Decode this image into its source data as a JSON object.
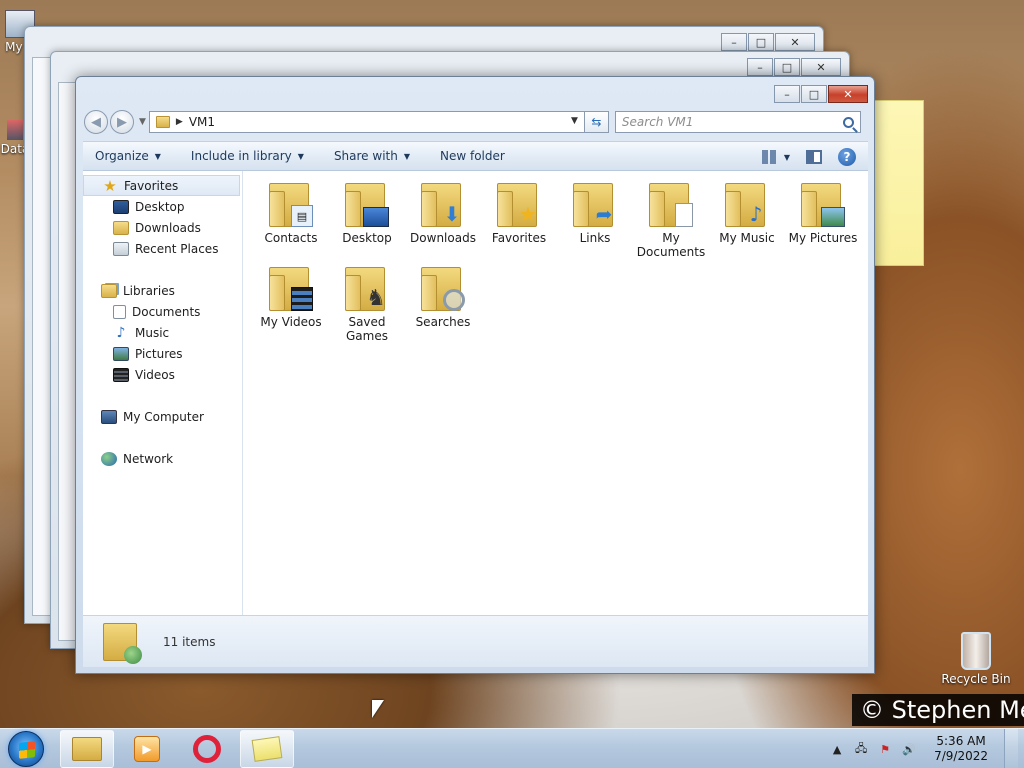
{
  "desktop": {
    "icons": [
      {
        "label": "My C"
      },
      {
        "label": "Data"
      },
      {
        "label": "Recycle Bin"
      }
    ],
    "watermark": "© Stephen Me"
  },
  "window": {
    "title": "VM1",
    "address_path": "VM1",
    "search_placeholder": "Search VM1",
    "caption": {
      "minimize": "–",
      "maximize": "□",
      "close": "✕"
    }
  },
  "toolbar": {
    "organize": "Organize",
    "include_in_library": "Include in library",
    "share_with": "Share with",
    "new_folder": "New folder"
  },
  "nav_pane": {
    "favorites": {
      "label": "Favorites",
      "items": [
        "Desktop",
        "Downloads",
        "Recent Places"
      ]
    },
    "libraries": {
      "label": "Libraries",
      "items": [
        "Documents",
        "Music",
        "Pictures",
        "Videos"
      ]
    },
    "computer": "My Computer",
    "network": "Network"
  },
  "files": [
    {
      "name": "Contacts",
      "icon": "contacts-icon"
    },
    {
      "name": "Desktop",
      "icon": "desktop-icon"
    },
    {
      "name": "Downloads",
      "icon": "downloads-icon"
    },
    {
      "name": "Favorites",
      "icon": "star-icon"
    },
    {
      "name": "Links",
      "icon": "link-arrow-icon"
    },
    {
      "name": "My Documents",
      "icon": "document-icon"
    },
    {
      "name": "My Music",
      "icon": "music-note-icon"
    },
    {
      "name": "My Pictures",
      "icon": "picture-icon"
    },
    {
      "name": "My Videos",
      "icon": "film-icon"
    },
    {
      "name": "Saved Games",
      "icon": "chess-icon"
    },
    {
      "name": "Searches",
      "icon": "magnifier-icon"
    }
  ],
  "details": {
    "item_count": "11 items"
  },
  "taskbar": {
    "clock_time": "5:36 AM",
    "clock_date": "7/9/2022",
    "pinned": [
      "windows-explorer",
      "media-player",
      "opera",
      "sticky-notes"
    ]
  }
}
